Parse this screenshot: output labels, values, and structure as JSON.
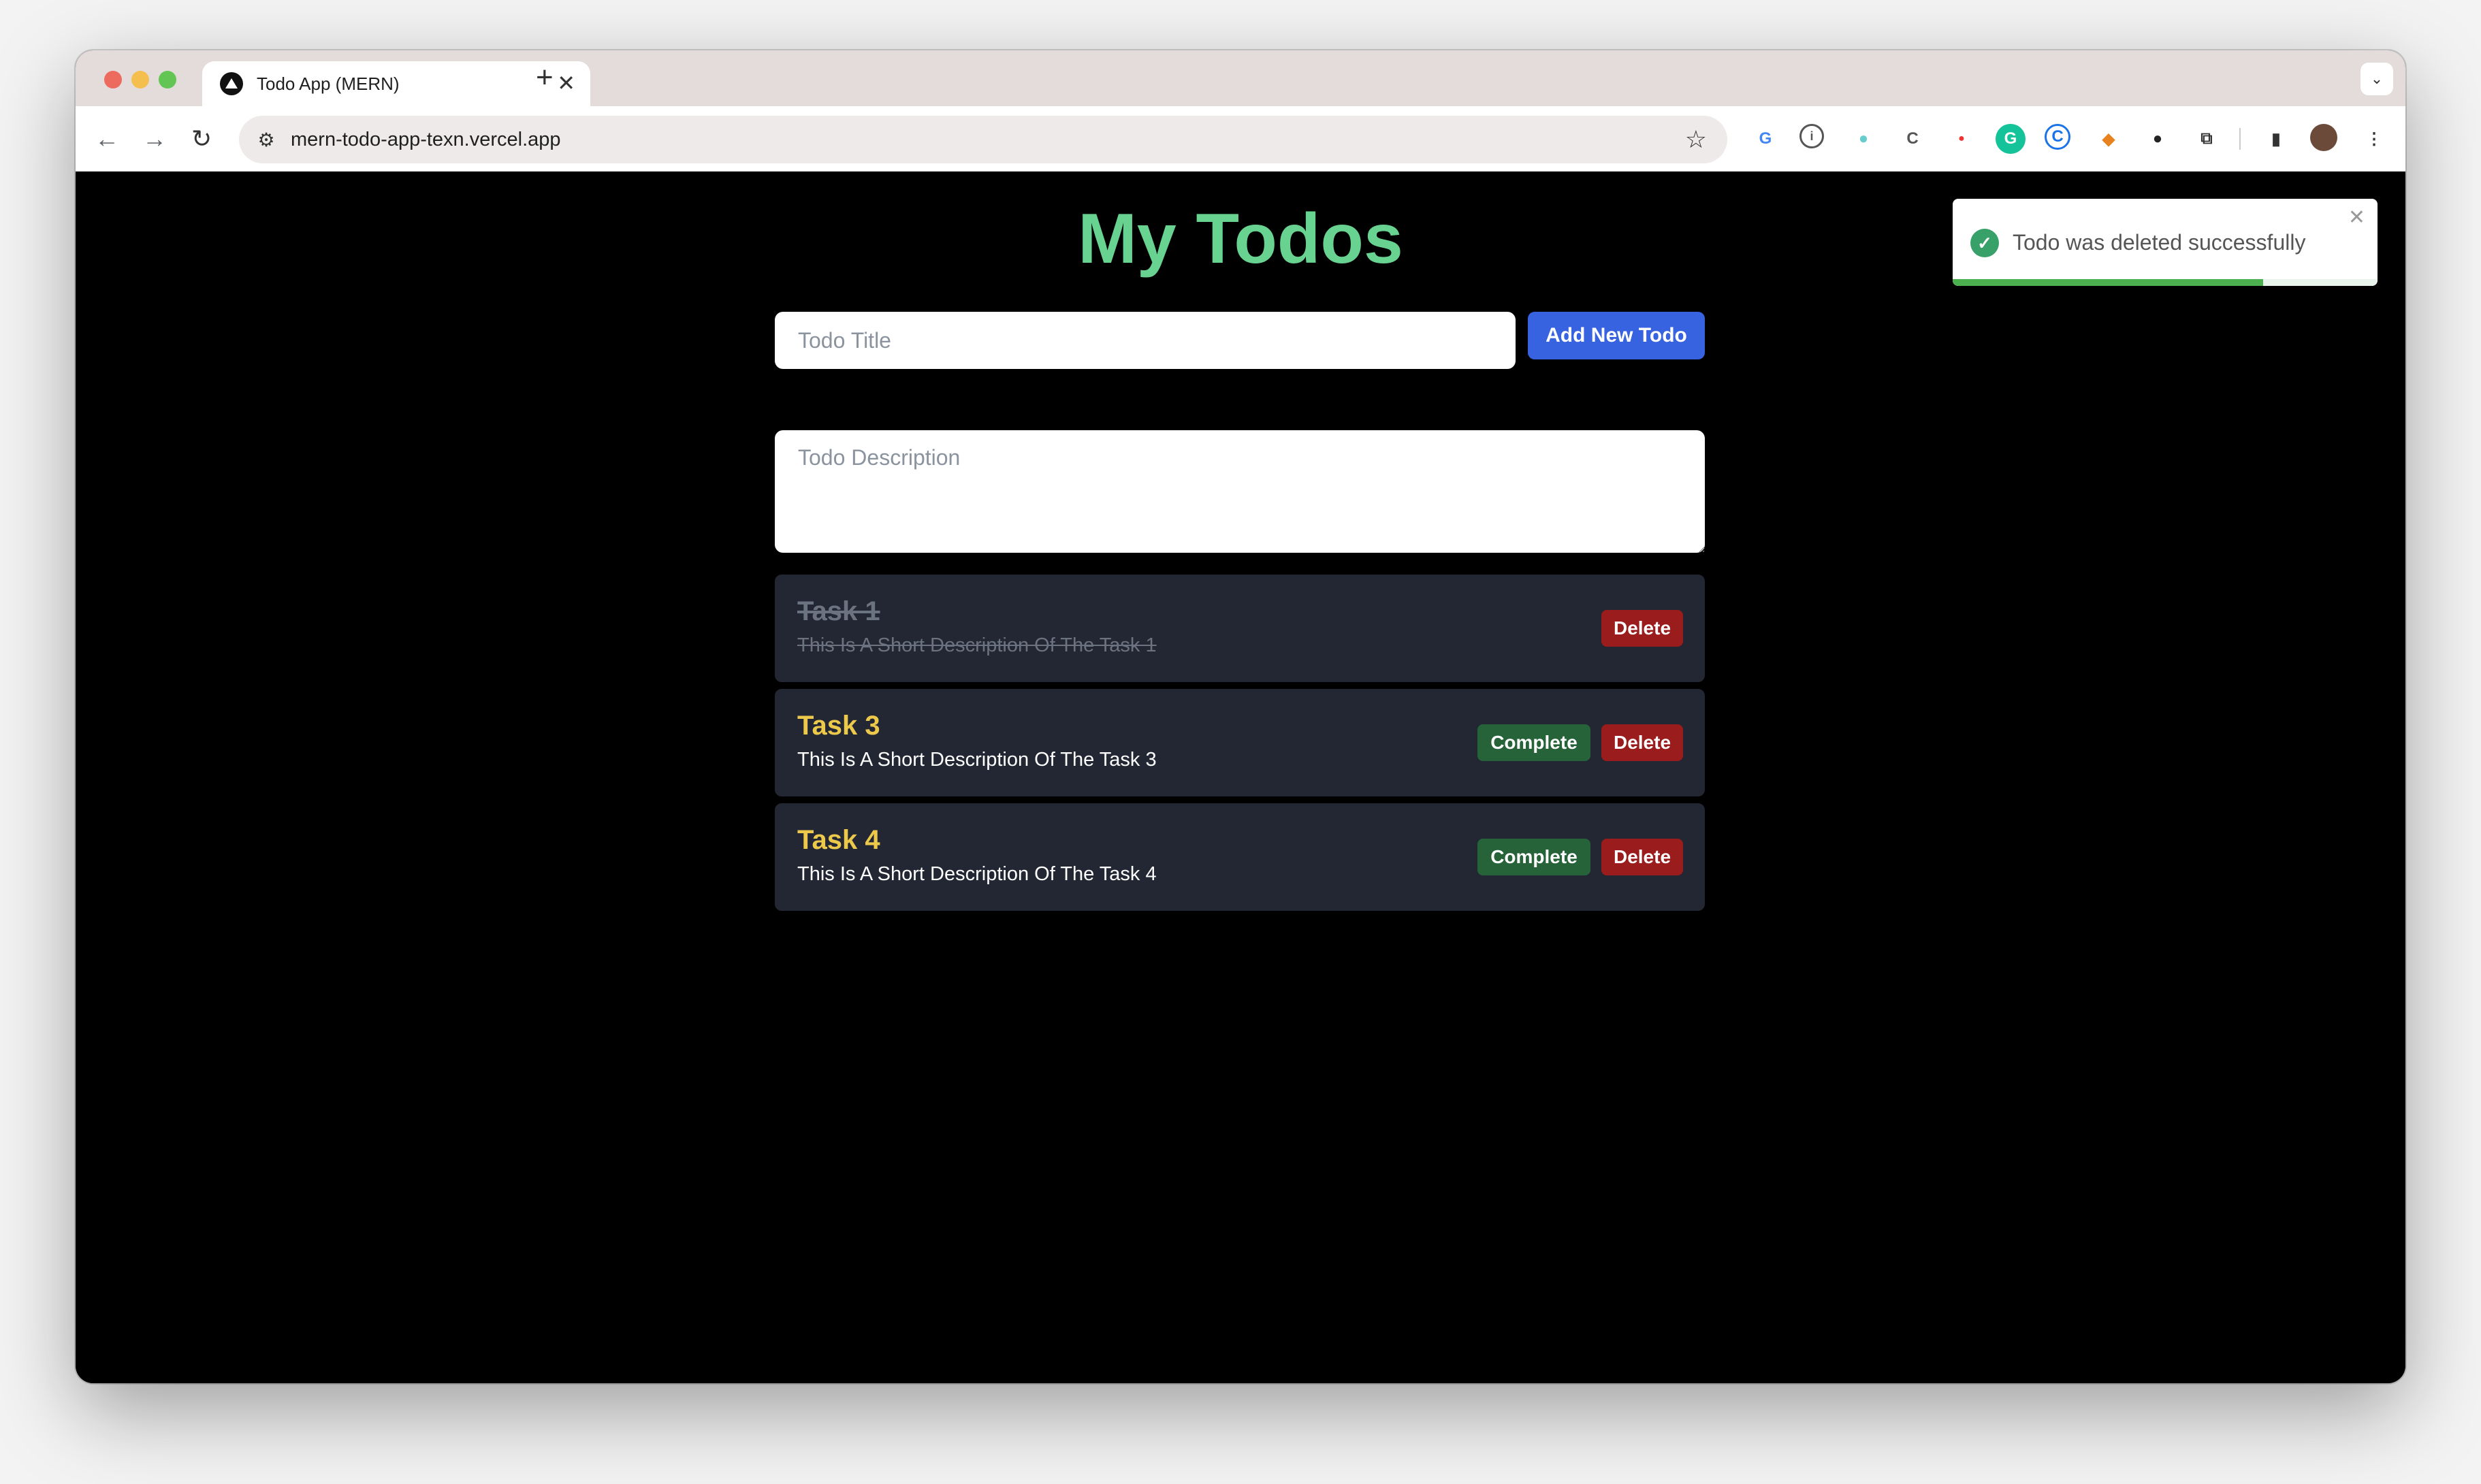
{
  "browser": {
    "tab_title": "Todo App (MERN)",
    "tab_close": "✕",
    "new_tab": "+",
    "url": "mern-todo-app-texn.vercel.app"
  },
  "page": {
    "heading": "My Todos",
    "title_placeholder": "Todo Title",
    "description_placeholder": "Todo Description",
    "add_button": "Add New Todo"
  },
  "todos": [
    {
      "title": "Task 1",
      "description": "This Is A Short Description Of The Task 1",
      "completed": true,
      "delete_label": "Delete"
    },
    {
      "title": "Task 3",
      "description": "This Is A Short Description Of The Task 3",
      "completed": false,
      "complete_label": "Complete",
      "delete_label": "Delete"
    },
    {
      "title": "Task 4",
      "description": "This Is A Short Description Of The Task 4",
      "completed": false,
      "complete_label": "Complete",
      "delete_label": "Delete"
    }
  ],
  "toast": {
    "message": "Todo was deleted successfully",
    "close": "✕",
    "progress": 0.73,
    "status_color": "#38a169"
  },
  "colors": {
    "heading": "#68d391",
    "task_title": "#ecc94b",
    "add_button": "#3863e0",
    "complete_button": "#276338",
    "delete_button": "#9b1c1c",
    "card_bg": "#222733"
  }
}
